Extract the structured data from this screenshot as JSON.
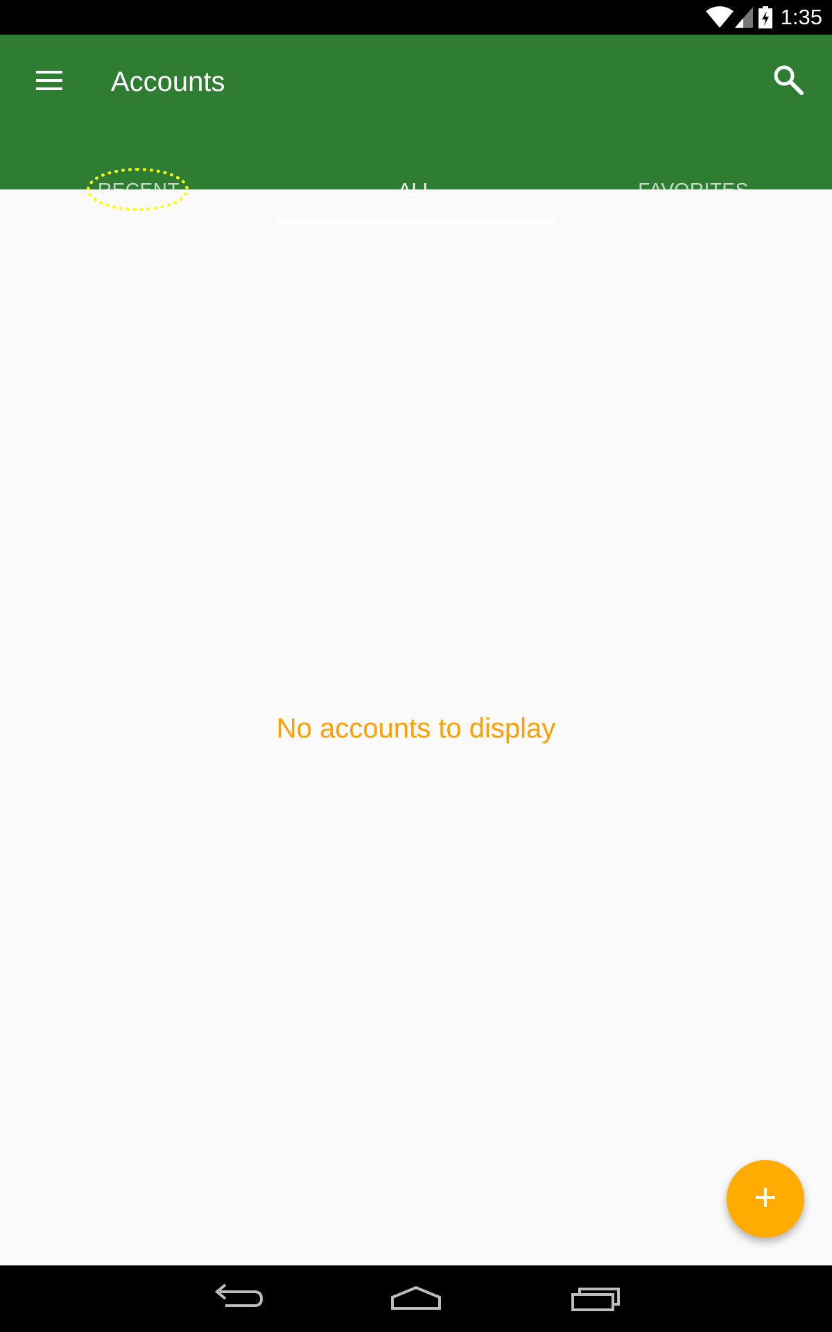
{
  "status_bar": {
    "time": "1:35",
    "icons": [
      "wifi-icon",
      "cell-signal-icon",
      "battery-charging-icon"
    ]
  },
  "app_bar": {
    "title": "Accounts",
    "menu_icon": "hamburger-menu-icon",
    "search_icon": "search-icon",
    "background_color": "#2e7d32"
  },
  "tabs": [
    {
      "label": "RECENT",
      "active": false,
      "highlighted": true
    },
    {
      "label": "ALL",
      "active": true,
      "highlighted": false
    },
    {
      "label": "FAVORITES",
      "active": false,
      "highlighted": false
    }
  ],
  "main": {
    "empty_message": "No accounts to display",
    "empty_message_color": "#ffa000"
  },
  "fab": {
    "icon": "plus-icon",
    "color": "#ffab00"
  },
  "nav_bar": {
    "buttons": [
      "back-icon",
      "home-icon",
      "recent-apps-icon"
    ]
  }
}
